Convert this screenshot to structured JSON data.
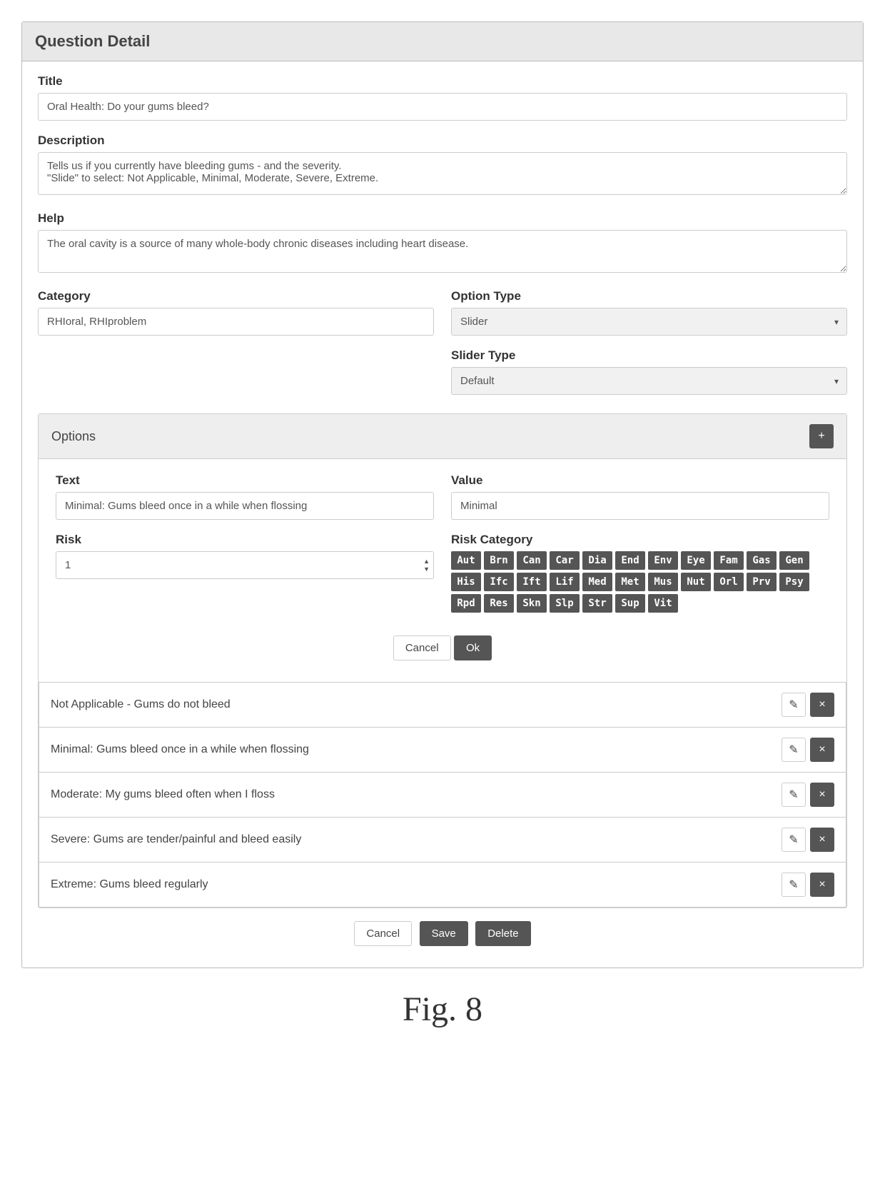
{
  "header": "Question Detail",
  "labels": {
    "title": "Title",
    "description": "Description",
    "help": "Help",
    "category": "Category",
    "option_type": "Option Type",
    "slider_type": "Slider Type",
    "text": "Text",
    "value": "Value",
    "risk": "Risk",
    "risk_category": "Risk Category",
    "options": "Options"
  },
  "fields": {
    "title": "Oral Health: Do your gums bleed?",
    "description": "Tells us if you currently have bleeding gums - and the severity.\n\"Slide\" to select: Not Applicable, Minimal, Moderate, Severe, Extreme.",
    "help": "The oral cavity is a source of many whole-body chronic diseases including heart disease.",
    "category": "RHIoral, RHIproblem",
    "option_type": "Slider",
    "slider_type": "Default"
  },
  "option_form": {
    "text": "Minimal: Gums bleed once in a while when flossing",
    "value": "Minimal",
    "risk": "1"
  },
  "risk_categories": [
    "Aut",
    "Brn",
    "Can",
    "Car",
    "Dia",
    "End",
    "Env",
    "Eye",
    "Fam",
    "Gas",
    "Gen",
    "His",
    "Ifc",
    "Ift",
    "Lif",
    "Med",
    "Met",
    "Mus",
    "Nut",
    "Orl",
    "Prv",
    "Psy",
    "Rpd",
    "Res",
    "Skn",
    "Slp",
    "Str",
    "Sup",
    "Vit"
  ],
  "buttons": {
    "cancel": "Cancel",
    "ok": "Ok",
    "save": "Save",
    "delete": "Delete"
  },
  "options_list": [
    "Not Applicable - Gums do not bleed",
    "Minimal: Gums bleed once in a while when flossing",
    "Moderate: My gums bleed often when I floss",
    "Severe: Gums are tender/painful and bleed easily",
    "Extreme: Gums bleed regularly"
  ],
  "figure_label": "Fig. 8"
}
